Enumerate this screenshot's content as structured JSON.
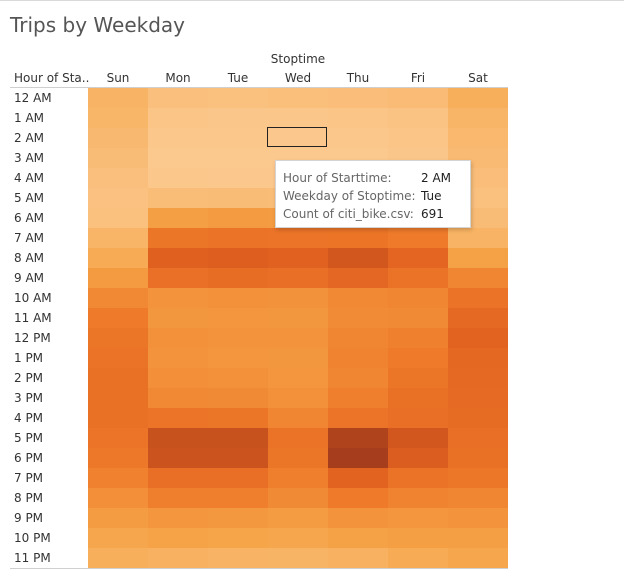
{
  "title": "Trips by Weekday",
  "chart_data": {
    "type": "heatmap",
    "title": "Trips by Weekday",
    "column_title": "Stoptime",
    "row_header": "Hour of Sta..",
    "columns": [
      "Sun",
      "Mon",
      "Tue",
      "Wed",
      "Thu",
      "Fri",
      "Sat"
    ],
    "rows": [
      "12 AM",
      "1 AM",
      "2 AM",
      "3 AM",
      "4 AM",
      "5 AM",
      "6 AM",
      "7 AM",
      "8 AM",
      "9 AM",
      "10 AM",
      "11 AM",
      "12 PM",
      "1 PM",
      "2 PM",
      "3 PM",
      "4 PM",
      "5 PM",
      "6 PM",
      "7 PM",
      "8 PM",
      "9 PM",
      "10 PM",
      "11 PM"
    ],
    "values": [
      [
        2800,
        1500,
        1400,
        1550,
        1600,
        1900,
        3200
      ],
      [
        2500,
        900,
        750,
        800,
        850,
        1100,
        2600
      ],
      [
        2200,
        700,
        691,
        650,
        700,
        900,
        2300
      ],
      [
        1800,
        600,
        550,
        560,
        600,
        750,
        2000
      ],
      [
        1500,
        700,
        650,
        680,
        700,
        850,
        1600
      ],
      [
        1300,
        1700,
        1800,
        1750,
        1800,
        1700,
        1400
      ],
      [
        1400,
        4800,
        5200,
        5000,
        4900,
        4500,
        1800
      ],
      [
        2600,
        8600,
        9000,
        8800,
        8900,
        8000,
        2800
      ],
      [
        3600,
        11600,
        11900,
        11500,
        12600,
        11000,
        4600
      ],
      [
        5200,
        9400,
        9800,
        9500,
        10500,
        9000,
        7000
      ],
      [
        6800,
        5800,
        6000,
        5900,
        6800,
        7000,
        9000
      ],
      [
        8000,
        5500,
        5600,
        5500,
        6500,
        6600,
        10400
      ],
      [
        8600,
        6000,
        5800,
        5700,
        7000,
        7500,
        11200
      ],
      [
        9000,
        5800,
        5600,
        5500,
        7200,
        8000,
        10600
      ],
      [
        9200,
        6200,
        6000,
        5600,
        7000,
        8600,
        10400
      ],
      [
        9300,
        6800,
        6600,
        6000,
        7600,
        9200,
        10200
      ],
      [
        9200,
        8800,
        8600,
        7000,
        8800,
        9600,
        10000
      ],
      [
        8800,
        13200,
        13200,
        9000,
        14800,
        12600,
        9600
      ],
      [
        8200,
        13000,
        13000,
        8600,
        15400,
        12000,
        9200
      ],
      [
        7400,
        9600,
        9600,
        7600,
        11200,
        9000,
        8400
      ],
      [
        6200,
        7600,
        7600,
        6600,
        8000,
        7200,
        7000
      ],
      [
        5000,
        5600,
        5400,
        5000,
        5800,
        5600,
        5800
      ],
      [
        4000,
        4400,
        4200,
        4000,
        4600,
        4800,
        4800
      ],
      [
        3200,
        3000,
        2800,
        2700,
        3000,
        3600,
        4000
      ]
    ],
    "color_scale": [
      "#fbc88e",
      "#f6a548",
      "#ee7a2a",
      "#e0601f",
      "#a63d1c"
    ],
    "selected_cell": {
      "row": "2 AM",
      "column": "Tue"
    },
    "grid": false
  },
  "tooltip": {
    "rows": [
      {
        "key": "Hour of Starttime:",
        "value": "2 AM"
      },
      {
        "key": "Weekday of Stoptime:",
        "value": "Tue"
      },
      {
        "key": "Count of citi_bike.csv:",
        "value": "691"
      }
    ]
  }
}
